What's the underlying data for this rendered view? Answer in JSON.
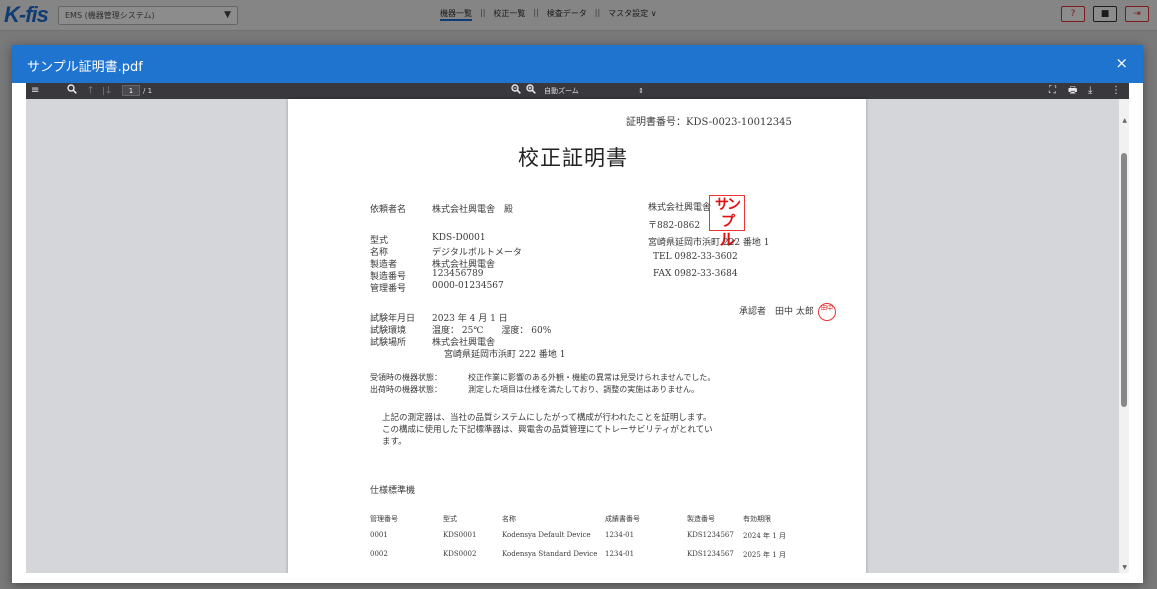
{
  "app": {
    "logo": "K-fis",
    "system_select": "EMS (機器管理システム)",
    "nav": [
      "機器一覧",
      "校正一覧",
      "検査データ",
      "マスタ設定 ∨"
    ],
    "header_buttons": [
      "?",
      "👤",
      "⇥"
    ]
  },
  "modal": {
    "title": "サンプル証明書.pdf",
    "close": "×"
  },
  "toolbar": {
    "page_input": "1",
    "page_total": "/ 1",
    "zoom": "自動ズーム",
    "icons": [
      "menu-icon",
      "search-icon",
      "arrow-up-icon",
      "arrow-down-icon",
      "zoom-out-icon",
      "zoom-in-icon",
      "fullscreen-icon",
      "print-icon",
      "download-icon",
      "more-icon"
    ]
  },
  "doc": {
    "cert_no": "証明書番号：KDS-0023-10012345",
    "title": "校正証明書",
    "client_label": "依頼者名",
    "client_value": "株式会社興電舎　殿",
    "issuer_name": "株式会社興電舎",
    "seal_text": "サンプル",
    "seal_line1": "サンプ",
    "seal_line2": "ル",
    "postal": "〒882-0862",
    "address": "宮崎県延岡市浜町 222 番地 1",
    "tel": "TEL 0982-33-3602",
    "fax": "FAX 0982-33-3684",
    "approver": "承認者　田中 太郎",
    "hanko": "田中",
    "device": [
      {
        "label": "型式",
        "value": "KDS-D0001"
      },
      {
        "label": "名称",
        "value": "デジタルボルトメータ"
      },
      {
        "label": "製造者",
        "value": "株式会社興電舎"
      },
      {
        "label": "製造番号",
        "value": "123456789"
      },
      {
        "label": "管理番号",
        "value": "0000-01234567"
      }
    ],
    "test": [
      {
        "label": "試験年月日",
        "value": "2023 年 4 月 1 日"
      },
      {
        "label": "試験環境",
        "value": "温度：  25℃　　湿度：  60%"
      },
      {
        "label": "試験場所",
        "value": "株式会社興電舎"
      }
    ],
    "test_address": "宮崎県延岡市浜町 222 番地 1",
    "receive_label": "受領時の機器状態：",
    "receive_value": "校正作業に影響のある外観・機能の異常は見受けられませんでした。",
    "ship_label": "出荷時の機器状態：",
    "ship_value": "測定した項目は仕様を満たしており、調整の実施はありません。",
    "statement1": "上記の測定器は、当社の品質システムにしたがって構成が行われたことを証明します。",
    "statement2": "この構成に使用した下記標準器は、興電舎の品質管理にてトレーサビリティがとれてい",
    "statement3": "ます。",
    "std_title": "仕様標準機",
    "std_headers": [
      "管理番号",
      "型式",
      "名称",
      "成績書番号",
      "製造番号",
      "有効期限"
    ],
    "std_rows": [
      [
        "0001",
        "KDS0001",
        "Kodensya Default Device",
        "1234-01",
        "KDS1234567",
        "2024 年 1 月"
      ],
      [
        "0002",
        "KDS0002",
        "Kodensya Standard Device",
        "1234-01",
        "KDS1234567",
        "2025 年 1 月"
      ]
    ]
  }
}
